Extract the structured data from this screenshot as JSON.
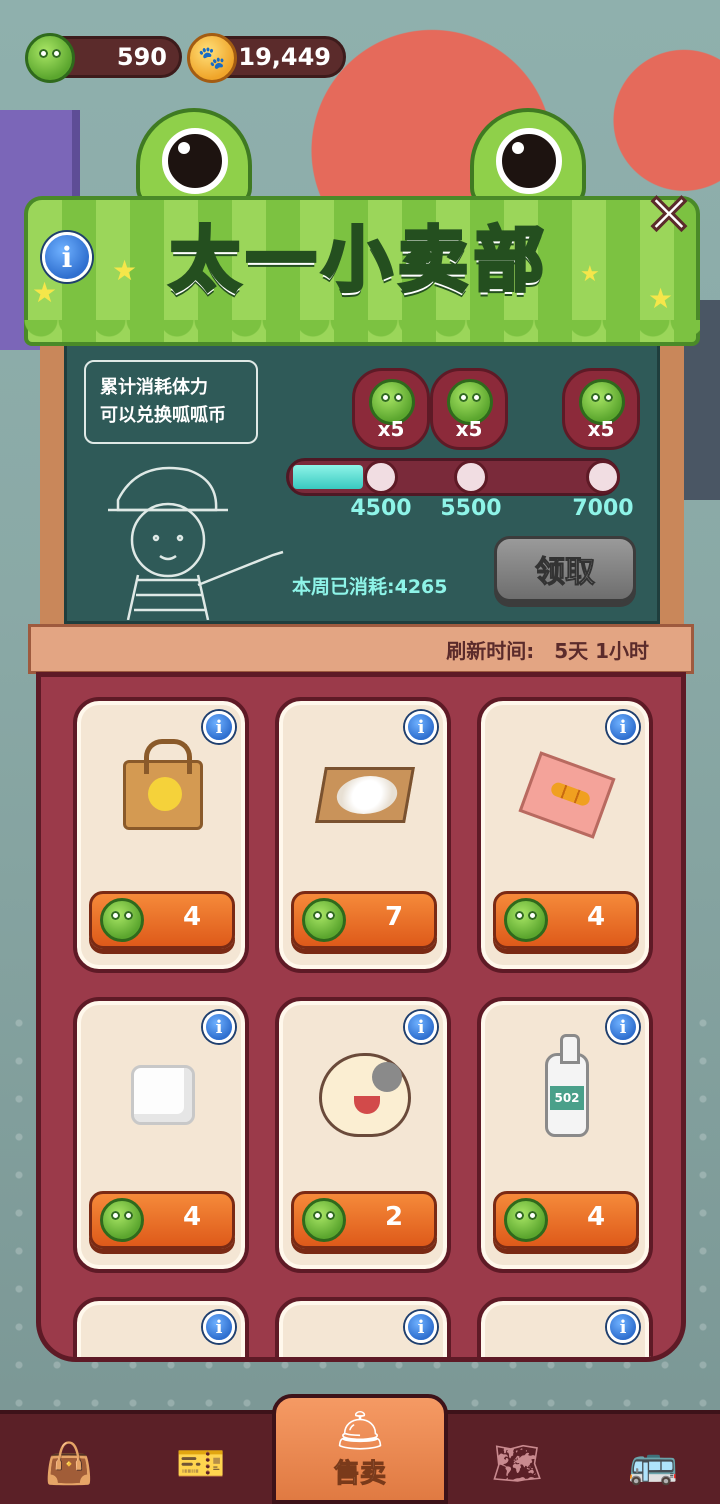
{
  "currency": {
    "frog_coins": "590",
    "paw_coins": "19,449"
  },
  "shop": {
    "title": "太一小卖部",
    "note_line1": "累计消耗体力",
    "note_line2": "可以兑换呱呱币",
    "rewards": [
      {
        "qty": "x5",
        "threshold": "4500"
      },
      {
        "qty": "x5",
        "threshold": "5500"
      },
      {
        "qty": "x5",
        "threshold": "7000"
      }
    ],
    "progress_fraction": 0.22,
    "claim_label": "领取",
    "consumed_text": "本周已消耗:4265",
    "refresh_label": "刷新时间:",
    "refresh_value": "5天 1小时"
  },
  "items": [
    {
      "name": "paper-bag",
      "price": "4"
    },
    {
      "name": "rice-tray",
      "price": "7"
    },
    {
      "name": "skewer-snack",
      "price": "4"
    },
    {
      "name": "sugar-cube",
      "price": "4"
    },
    {
      "name": "cat-sticker",
      "price": "2"
    },
    {
      "name": "glue-bottle",
      "price": "4"
    }
  ],
  "nav": {
    "active_label": "售卖",
    "tabs": [
      "bag-icon",
      "ticket-icon",
      "sell-icon",
      "map-icon",
      "bus-icon"
    ]
  },
  "colors": {
    "panel": "#9b3a4a",
    "awning": "#7cc241",
    "board": "#2f5a58",
    "price_button": "#de5a1a",
    "progress": "#39c9c0"
  }
}
